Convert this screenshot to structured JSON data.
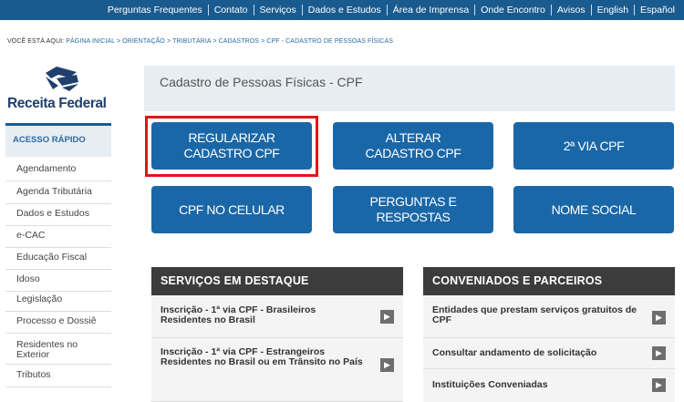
{
  "topnav": {
    "items": [
      "Perguntas Frequentes",
      "Contato",
      "Serviços",
      "Dados e Estudos",
      "Área de Imprensa",
      "Onde Encontro",
      "Avisos",
      "English",
      "Español"
    ]
  },
  "breadcrumb": {
    "lead": "VOCÊ ESTÁ AQUI:",
    "path": "PÁGINA INICIAL > ORIENTAÇÃO > TRIBUTÁRIA > CADASTROS > CPF - CADASTRO DE PESSOAS FÍSICAS"
  },
  "logo": {
    "text": "Receita Federal"
  },
  "sidebar": {
    "heading": "ACESSO RÁPIDO",
    "items": [
      "Agendamento",
      "Agenda Tributária",
      "Dados e Estudos",
      "e-CAC",
      "Educação Fiscal",
      "Idoso",
      "Legislação",
      "Processo e Dossiê",
      "Residentes no Exterior",
      "Tributos"
    ]
  },
  "page": {
    "title": "Cadastro de Pessoas Físicas - CPF"
  },
  "buttons": {
    "regularizar": "REGULARIZAR CADASTRO CPF",
    "alterar": "ALTERAR CADASTRO CPF",
    "segunda_via": "2ª VIA CPF",
    "celular": "CPF NO CELULAR",
    "perguntas": "PERGUNTAS E RESPOSTAS",
    "nome_social": "NOME SOCIAL"
  },
  "servicos": {
    "heading": "SERVIÇOS EM DESTAQUE",
    "rows": [
      "Inscrição - 1ª via CPF - Brasileiros Residentes no Brasil",
      "Inscrição - 1ª via CPF - Estrangeiros Residentes no Brasil ou em Trânsito no País"
    ]
  },
  "conveniados": {
    "heading": "CONVENIADOS E PARCEIROS",
    "rows": [
      "Entidades que prestam serviços gratuitos de CPF",
      "Consultar andamento de solicitação",
      "Instituições Conveniadas"
    ]
  },
  "colors": {
    "brand_blue": "#1a67a8",
    "topbar": "#1a5b8f",
    "highlight_red": "#e0151b",
    "panel_dark": "#3c3c3c"
  },
  "icons": {
    "row_arrow": "chevron-right-icon"
  }
}
